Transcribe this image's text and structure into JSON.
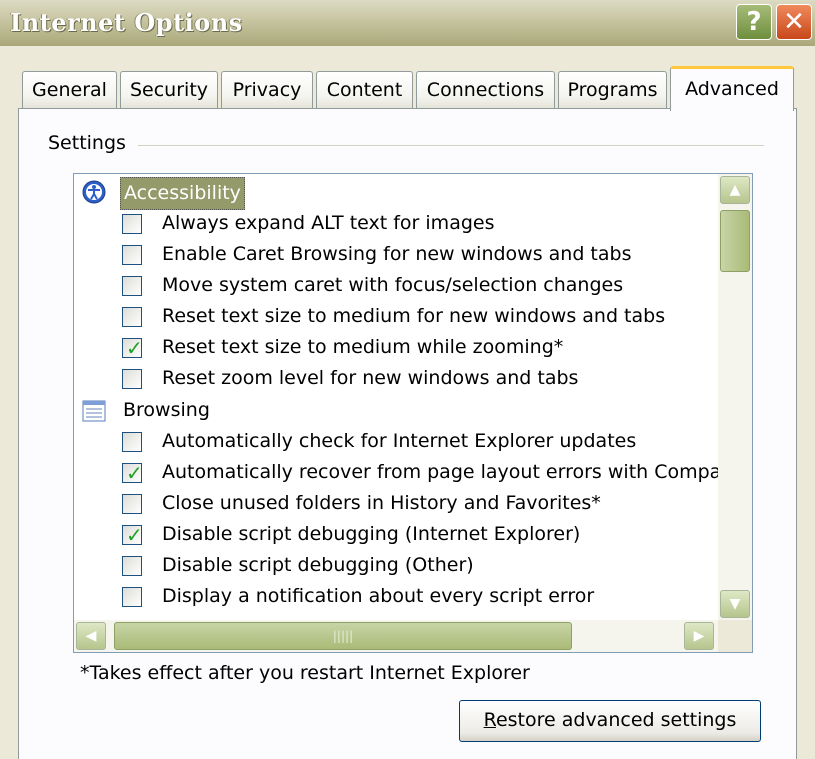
{
  "window": {
    "title": "Internet Options",
    "help_glyph": "?",
    "close_glyph": "✕"
  },
  "tabs": [
    {
      "label": "General"
    },
    {
      "label": "Security"
    },
    {
      "label": "Privacy"
    },
    {
      "label": "Content"
    },
    {
      "label": "Connections"
    },
    {
      "label": "Programs"
    },
    {
      "label": "Advanced",
      "active": true
    }
  ],
  "group": {
    "label": "Settings"
  },
  "settings": {
    "accessibility": {
      "label": "Accessibility",
      "items": [
        {
          "label": "Always expand ALT text for images",
          "checked": false
        },
        {
          "label": "Enable Caret Browsing for new windows and tabs",
          "checked": false
        },
        {
          "label": "Move system caret with focus/selection changes",
          "checked": false
        },
        {
          "label": "Reset text size to medium for new windows and tabs",
          "checked": false
        },
        {
          "label": "Reset text size to medium while zooming*",
          "checked": true
        },
        {
          "label": "Reset zoom level for new windows and tabs",
          "checked": false
        }
      ]
    },
    "browsing": {
      "label": "Browsing",
      "items": [
        {
          "label": "Automatically check for Internet Explorer updates",
          "checked": false
        },
        {
          "label": "Automatically recover from page layout errors with Compa",
          "checked": true
        },
        {
          "label": "Close unused folders in History and Favorites*",
          "checked": false
        },
        {
          "label": "Disable script debugging (Internet Explorer)",
          "checked": true
        },
        {
          "label": "Disable script debugging (Other)",
          "checked": false
        },
        {
          "label": "Display a notification about every script error",
          "checked": false
        }
      ]
    }
  },
  "scrollbar": {
    "thumb_grip": "|||||"
  },
  "footnote": "*Takes effect after you restart Internet Explorer",
  "restore_button": {
    "accel": "R",
    "rest": "estore advanced settings"
  },
  "colors": {
    "checkmark": "#21A121",
    "accent_tab": "#FFC83C",
    "highlight": "#949A6A"
  }
}
